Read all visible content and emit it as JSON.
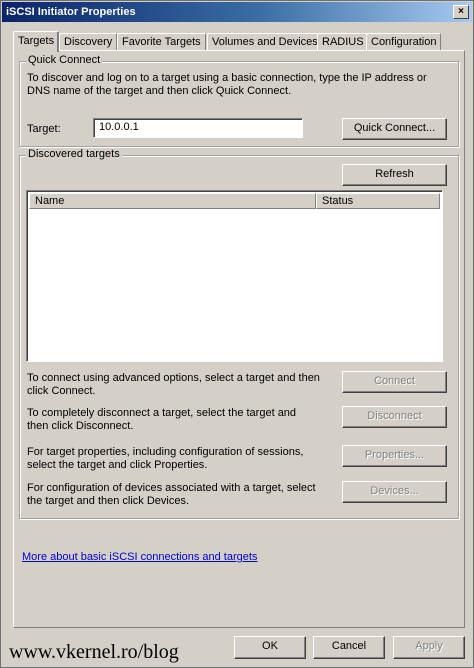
{
  "window": {
    "title": "iSCSI Initiator Properties",
    "close_glyph": "×"
  },
  "tabs": [
    {
      "label": "Targets"
    },
    {
      "label": "Discovery"
    },
    {
      "label": "Favorite Targets"
    },
    {
      "label": "Volumes and Devices"
    },
    {
      "label": "RADIUS"
    },
    {
      "label": "Configuration"
    }
  ],
  "quick_connect": {
    "group_label": "Quick Connect",
    "description_line1": "To discover and log on to a target using a basic connection, type the IP address or",
    "description_line2": "DNS name of the target and then click Quick Connect.",
    "target_label": "Target:",
    "target_value": "10.0.0.1",
    "button_label": "Quick Connect..."
  },
  "discovered": {
    "group_label": "Discovered targets",
    "refresh_label": "Refresh",
    "columns": [
      "Name",
      "Status"
    ],
    "actions": [
      {
        "line1": "To connect using advanced options, select a target and then",
        "line2": "click Connect.",
        "button": "Connect"
      },
      {
        "line1": "To completely disconnect a target, select the target and",
        "line2": "then click Disconnect.",
        "button": "Disconnect"
      },
      {
        "line1": "For target properties, including configuration of sessions,",
        "line2": "select the target and click Properties.",
        "button": "Properties..."
      },
      {
        "line1": "For configuration of devices associated with a target, select",
        "line2": "the target and then click Devices.",
        "button": "Devices..."
      }
    ]
  },
  "help_link": "More about basic iSCSI connections and targets",
  "footer": {
    "ok": "OK",
    "cancel": "Cancel",
    "apply": "Apply"
  },
  "watermark": "www.vkernel.ro/blog"
}
